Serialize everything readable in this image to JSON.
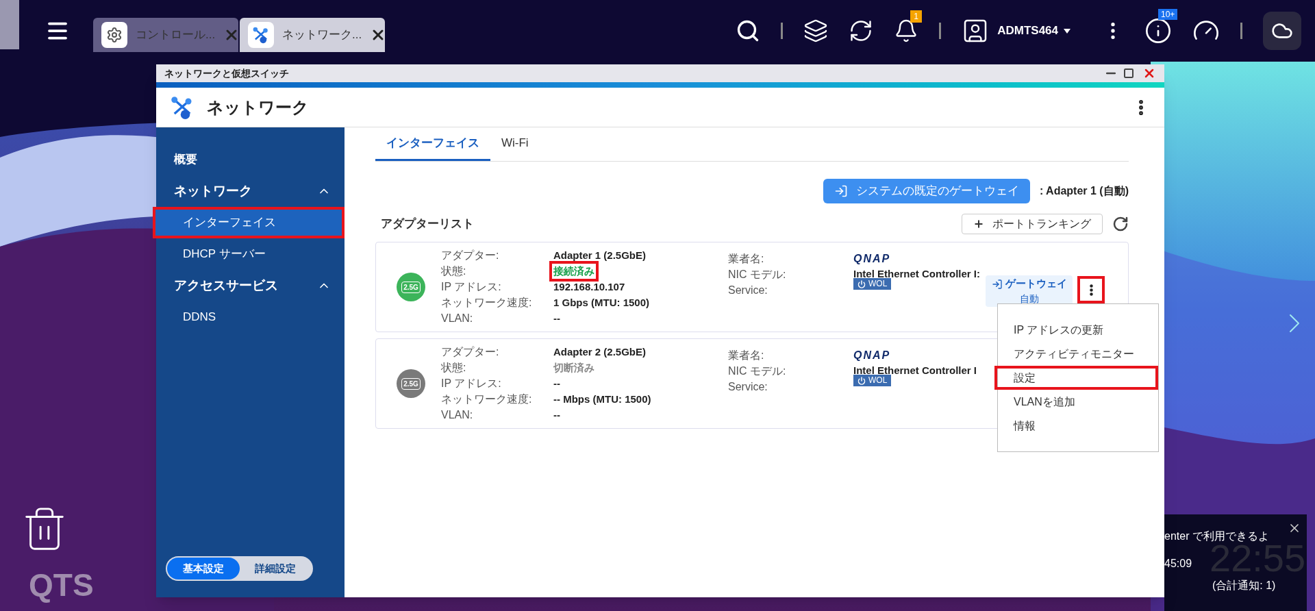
{
  "taskbar": {
    "tabs": [
      {
        "label": "コントロール...",
        "selected": false,
        "kind": "settings"
      },
      {
        "label": "ネットワーク...",
        "selected": true,
        "kind": "network"
      }
    ],
    "bell_badge": "1",
    "user": "ADMTS464",
    "info_badge": "10+"
  },
  "window": {
    "title": "ネットワークと仮想スイッチ",
    "app_title": "ネットワーク"
  },
  "sidebar": {
    "items": [
      {
        "label": "概要",
        "kind": "link"
      },
      {
        "label": "ネットワーク",
        "kind": "group",
        "expanded": true,
        "children": [
          {
            "label": "インターフェイス",
            "selected": true,
            "annotated": true
          },
          {
            "label": "DHCP サーバー",
            "selected": false,
            "annotated": false
          }
        ]
      },
      {
        "label": "アクセスサービス",
        "kind": "group",
        "expanded": true,
        "children": [
          {
            "label": "DDNS",
            "selected": false,
            "annotated": false
          }
        ]
      }
    ],
    "mode_toggle": [
      {
        "label": "基本設定",
        "selected": true
      },
      {
        "label": "詳細設定",
        "selected": false
      }
    ]
  },
  "tabs": [
    {
      "label": "インターフェイス",
      "selected": true
    },
    {
      "label": "Wi-Fi",
      "selected": false
    }
  ],
  "gateway": {
    "button": "システムの既定のゲートウェイ",
    "value": ": Adapter 1 (自動)"
  },
  "adapter_list": {
    "title": "アダプターリスト",
    "trunk_button": "ポートトランキング"
  },
  "adapters": [
    {
      "badge": "2.5G",
      "connected": true,
      "menu_button": {
        "annotated": true
      },
      "rows": [
        {
          "label": "アダプター:",
          "value": "Adapter 1 (2.5GbE)",
          "kind": "text"
        },
        {
          "label": "状態:",
          "value": "接続済み",
          "kind": "status",
          "annotated": true
        },
        {
          "label": "IP アドレス:",
          "value": "192.168.10.107",
          "kind": "text"
        },
        {
          "label": "ネットワーク速度:",
          "value": "1 Gbps (MTU: 1500)",
          "kind": "text"
        },
        {
          "label": "VLAN:",
          "value": "--",
          "kind": "text"
        }
      ],
      "vendor_rows": [
        {
          "label": "業者名:",
          "value": "QNAP",
          "kind": "logo"
        },
        {
          "label": "NIC モデル:",
          "value": "Intel Ethernet Controller I:",
          "kind": "text"
        },
        {
          "label": "Service:",
          "value": "WOL",
          "kind": "badge"
        }
      ],
      "gateway": {
        "label": "ゲートウェイ",
        "value": "自動"
      }
    },
    {
      "badge": "2.5G",
      "connected": false,
      "rows": [
        {
          "label": "アダプター:",
          "value": "Adapter 2 (2.5GbE)",
          "kind": "text"
        },
        {
          "label": "状態:",
          "value": "切断済み",
          "kind": "status",
          "annotated": false
        },
        {
          "label": "IP アドレス:",
          "value": "--",
          "kind": "text"
        },
        {
          "label": "ネットワーク速度:",
          "value": "-- Mbps (MTU: 1500)",
          "kind": "text"
        },
        {
          "label": "VLAN:",
          "value": "--",
          "kind": "text"
        }
      ],
      "vendor_rows": [
        {
          "label": "業者名:",
          "value": "QNAP",
          "kind": "logo"
        },
        {
          "label": "NIC モデル:",
          "value": "Intel Ethernet Controller I",
          "kind": "text"
        },
        {
          "label": "Service:",
          "value": "WOL",
          "kind": "badge"
        }
      ]
    }
  ],
  "context_menu": {
    "items": [
      {
        "label": "IP アドレスの更新",
        "annotated": false
      },
      {
        "label": "アクティビティモニター",
        "annotated": false
      },
      {
        "label": "設定",
        "annotated": true
      },
      {
        "label": "VLANを追加",
        "annotated": false
      },
      {
        "label": "情報",
        "annotated": false
      }
    ]
  },
  "notification": {
    "lines": [
      "enter で利用できるよ",
      "45:09"
    ],
    "clock": "22:55",
    "summary": "(合計通知: 1)"
  },
  "desktop": {
    "logo": "QTS"
  }
}
